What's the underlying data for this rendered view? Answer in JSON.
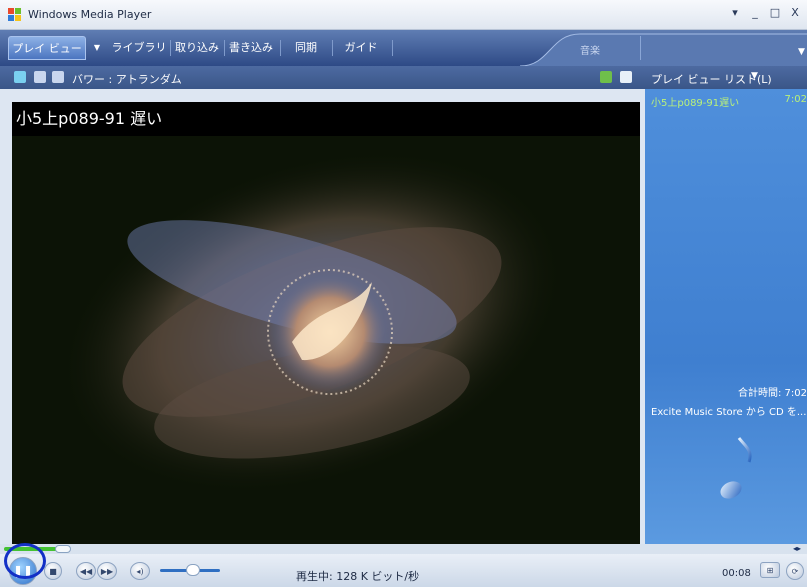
{
  "window": {
    "title": "Windows Media Player",
    "controls": {
      "menu": "▾",
      "minimize": "_",
      "maximize": "□",
      "close": "X"
    }
  },
  "tabs": [
    {
      "label": "プレイ ビュー",
      "active": true
    },
    {
      "label": "ライブラリ"
    },
    {
      "label": "取り込み"
    },
    {
      "label": "書き込み"
    },
    {
      "label": "同期"
    },
    {
      "label": "ガイド"
    }
  ],
  "tabbar": {
    "music_label": "音楽"
  },
  "subheader": {
    "visualization_label": "バワー : アトランダム"
  },
  "playlist": {
    "header_label": "プレイ ビュー リスト(L)",
    "items": [
      {
        "title": "小5上p089-91遅い",
        "duration": "7:02"
      }
    ],
    "total_time": "合計時間: 7:02",
    "store_link": "Excite Music Store から CD を..."
  },
  "video": {
    "track_title": "小5上p089-91 遅い"
  },
  "seek": {
    "progress_fraction": 0.07
  },
  "transport": {
    "pause_icon": "pause-icon",
    "status_text": "再生中: 128 K ビット/秒",
    "elapsed": "00:08",
    "volume_fraction": 0.55
  },
  "colors": {
    "accent": "#2e4a86",
    "playlist_bg": "#4f8fdb",
    "playing_item": "#b9f07a",
    "ring": "#1330c6"
  }
}
